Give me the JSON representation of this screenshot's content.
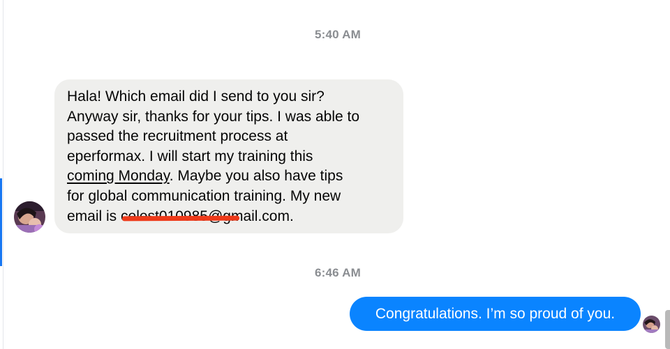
{
  "conversation": {
    "timestamps": [
      "5:40 AM",
      "6:46 AM"
    ],
    "incoming_message": {
      "line1": "Hala! Which email did I send to you sir?",
      "line2": "Anyway sir, thanks for your tips. I was able to",
      "line3": "passed the recruitment process at",
      "line4": "eperformax. I will start my training this",
      "link_text": "coming Monday",
      "line5_rest": ". Maybe you also have tips",
      "line6": "for global communication training. My new",
      "line7_prefix": "email is ",
      "redacted_text": "celest010985",
      "line7_suffix": "@gmail.com."
    },
    "outgoing_message": {
      "text": "Congratulations. I’m so proud of you."
    },
    "colors": {
      "incoming_bubble": "#efefed",
      "outgoing_bubble": "#0a84ff",
      "redaction": "#ee3a1a",
      "timestamp": "#8a8d91",
      "active_indicator": "#1877f2"
    }
  }
}
